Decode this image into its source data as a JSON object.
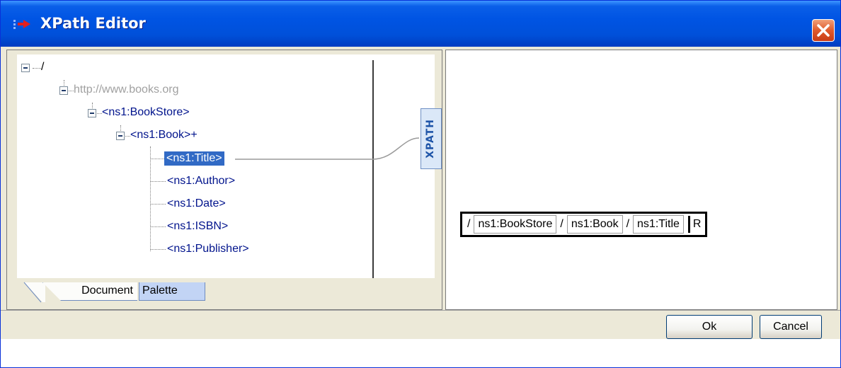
{
  "window": {
    "title": "XPath Editor",
    "icons": {
      "app": "xpath-app-icon",
      "close": "close-icon"
    },
    "colors": {
      "titlebar": "#0054e3",
      "close_button": "#e05a2c",
      "selection": "#316ac5"
    }
  },
  "tree": {
    "root": "/",
    "namespace": "http://www.books.org",
    "bookstore": "<ns1:BookStore>",
    "book": "<ns1:Book>+",
    "children": [
      "<ns1:Title>",
      "<ns1:Author>",
      "<ns1:Date>",
      "<ns1:ISBN>",
      "<ns1:Publisher>"
    ],
    "selected": "<ns1:Title>"
  },
  "tabs": [
    "Document",
    "Palette"
  ],
  "connector": {
    "label": "XPATH"
  },
  "path": {
    "root_sep": "/",
    "segments": [
      "ns1:BookStore",
      "ns1:Book",
      "ns1:Title"
    ],
    "separator": "/",
    "suffix": "R"
  },
  "buttons": {
    "ok": "Ok",
    "cancel": "Cancel"
  }
}
